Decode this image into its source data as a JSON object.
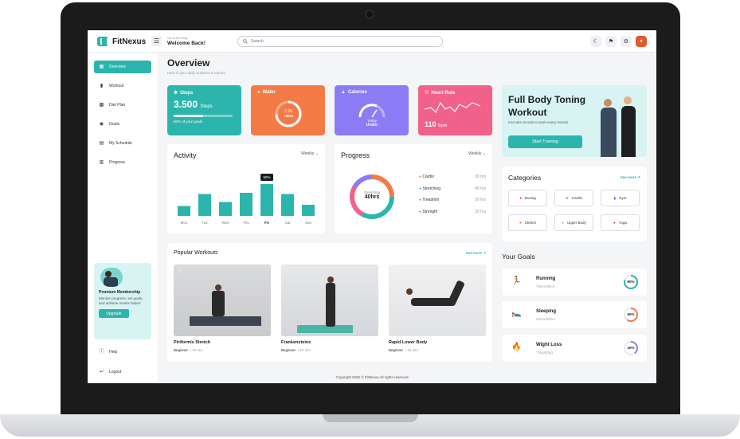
{
  "app": {
    "name": "FitNexus",
    "greeting_small": "Good Morning",
    "greeting": "Welcome Back!"
  },
  "search": {
    "placeholder": "Search"
  },
  "top_icons": [
    "moon-icon",
    "bell-icon",
    "gear-icon",
    "avatar"
  ],
  "sidebar": {
    "items": [
      {
        "label": "Overview",
        "icon": "grid-icon",
        "active": true
      },
      {
        "label": "Workout",
        "icon": "dumbbell-icon",
        "active": false
      },
      {
        "label": "Diet Plan",
        "icon": "clipboard-icon",
        "active": false
      },
      {
        "label": "Goals",
        "icon": "goal-icon",
        "active": false
      },
      {
        "label": "My Schedule",
        "icon": "calendar-icon",
        "active": false
      },
      {
        "label": "Progress",
        "icon": "bar-chart-icon",
        "active": false
      }
    ],
    "promo": {
      "title": "Premium Membership",
      "desc": "Monitor progress, set goals, and achieve results faster!",
      "button": "Upgrade"
    },
    "help": "Help",
    "logout": "Logout"
  },
  "page": {
    "title": "Overview",
    "subtitle": "Here is your daily activities & reports"
  },
  "stats": {
    "steps": {
      "label": "Steps",
      "value": "3.500",
      "unit": "Steps",
      "note": "50% of your goals",
      "progress": 0.5,
      "color": "#2bb5ad"
    },
    "water": {
      "label": "Water",
      "value": "2.25",
      "unit": "Liters",
      "color": "#f47b46"
    },
    "calories": {
      "label": "Calories",
      "sub": "Today",
      "value": "Under",
      "color": "#8b7cf6"
    },
    "heart": {
      "label": "Heart Rate",
      "value": "110",
      "unit": "Bpm",
      "color": "#f2618a"
    }
  },
  "hero": {
    "title": "Full Body Toning Workout",
    "desc": "Incrcuits circuits to work every muscle",
    "button": "Start Training"
  },
  "activity": {
    "title": "Activity",
    "range": "Weekly",
    "chart_data": {
      "type": "bar",
      "categories": [
        "Mon",
        "Tue",
        "Wed",
        "Thu",
        "Fri",
        "Sat",
        "Sun"
      ],
      "values": [
        25,
        55,
        35,
        58,
        80,
        55,
        28
      ],
      "highlight_label": "50%",
      "highlight_index": 4,
      "ylim": [
        0,
        100
      ],
      "color": "#2bb5ad"
    }
  },
  "progress": {
    "title": "Progress",
    "range": "Weekly",
    "center_label": "Stretching",
    "center_value": "40hrs",
    "items": [
      {
        "name": "Cardio",
        "hours": "30 hrs",
        "color": "#f47b46"
      },
      {
        "name": "Stretching",
        "hours": "40 hrs",
        "color": "#2bb5ad"
      },
      {
        "name": "Treadmill",
        "hours": "30 hrs",
        "color": "#f2618a"
      },
      {
        "name": "Strength",
        "hours": "20 hrs",
        "color": "#8b7cf6"
      }
    ]
  },
  "categories": {
    "title": "Categories",
    "see_more": "See more",
    "items": [
      {
        "label": "Boxing",
        "icon": "boxing-icon"
      },
      {
        "label": "Cardio",
        "icon": "cardio-icon"
      },
      {
        "label": "Gym",
        "icon": "gym-icon"
      },
      {
        "label": "Stretch",
        "icon": "stretch-icon"
      },
      {
        "label": "Upper Body",
        "icon": "upper-body-icon"
      },
      {
        "label": "Yoga",
        "icon": "yoga-icon"
      }
    ]
  },
  "popular": {
    "title": "Popular Workouts",
    "see_more": "See more",
    "items": [
      {
        "name": "Piriformis Stretch",
        "level": "Beginner",
        "duration": "20 sec"
      },
      {
        "name": "Frankensteins",
        "level": "Beginner",
        "duration": "10 min"
      },
      {
        "name": "Rapid Lower Body",
        "level": "Beginner",
        "duration": "15 min"
      }
    ]
  },
  "goals": {
    "title": "Your Goals",
    "items": [
      {
        "name": "Running",
        "sub": "70km/80km",
        "percent": "80%",
        "color": "#2bb5ad",
        "progress": 0.8
      },
      {
        "name": "Sleeping",
        "sub": "50hrs/60hrs",
        "percent": "60%",
        "color": "#f47b46",
        "progress": 0.6
      },
      {
        "name": "Wight Loss",
        "sub": "70kg/80kg",
        "percent": "40%",
        "color": "#8b7cf6",
        "progress": 0.4
      }
    ]
  },
  "footer": "Copyright 2025 © FitNexus All rights reserved"
}
